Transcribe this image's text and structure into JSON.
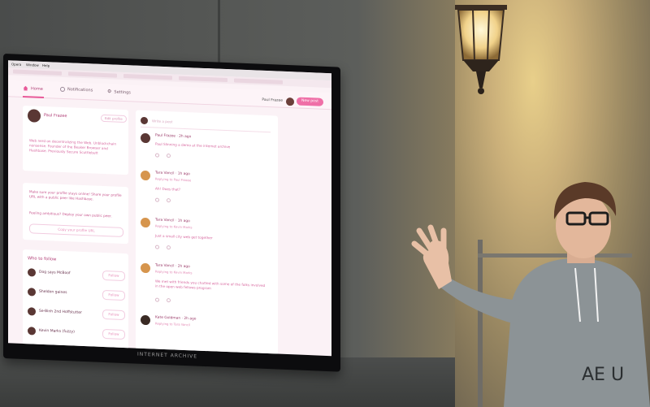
{
  "os_menu": [
    "Opera",
    "Window",
    "Help"
  ],
  "app_nav": {
    "home": "Home",
    "notifications": "Notifications",
    "settings": "Settings",
    "user_name": "Paul Frazee",
    "new_post": "New post"
  },
  "profile": {
    "name": "Paul Frazee",
    "edit_label": "Edit profile",
    "bio": "Web nerd on decentralizing the Web. Unblockchain nonsense. Founder of the Beaker Browser and Hashbase. Previously Secure Scuttlebutt"
  },
  "share_card": {
    "text": "Make sure your profile stays online! Share your profile URL with a public peer like Hashbase.",
    "feeling": "Feeling ambitious? Deploy your own public peer.",
    "copy_label": "Copy your profile URL"
  },
  "who_to_follow": {
    "title": "Who to follow",
    "follow_label": "Follow",
    "people": [
      "Dog says McBoof",
      "Sheldon gaines",
      "Se-Binh 2nd Hoffstutter",
      "Kevin Marks (fuzzy)"
    ]
  },
  "feed": {
    "compose_placeholder": "Write a post",
    "posts": [
      {
        "author": "Paul Frazee",
        "meta": "2h ago",
        "body": "Paul Slinning a demo at the internet archive"
      },
      {
        "author": "Tara Vancil",
        "meta": "1h ago",
        "sub": "Replying to Paul Frazee",
        "body": "Ah! Does that?"
      },
      {
        "author": "Tara Vancil",
        "meta": "1h ago",
        "sub": "Replying to Kevin Marks",
        "body": "Just a small city web get together"
      },
      {
        "author": "Tara Vancil",
        "meta": "2h ago",
        "sub": "Replying to Kevin Marks",
        "body": "We met with friends you chatted with some of the folks involved in the open web fellows program"
      },
      {
        "author": "Kate Goldman",
        "meta": "2h ago",
        "sub": "Replying to Tara Vancil",
        "body": ""
      }
    ]
  },
  "monitor_brand": "INTERNET ARCHIVE",
  "colors": {
    "accent": "#ef6fa7",
    "link": "#b03d75",
    "text_pink": "#d7689f"
  }
}
